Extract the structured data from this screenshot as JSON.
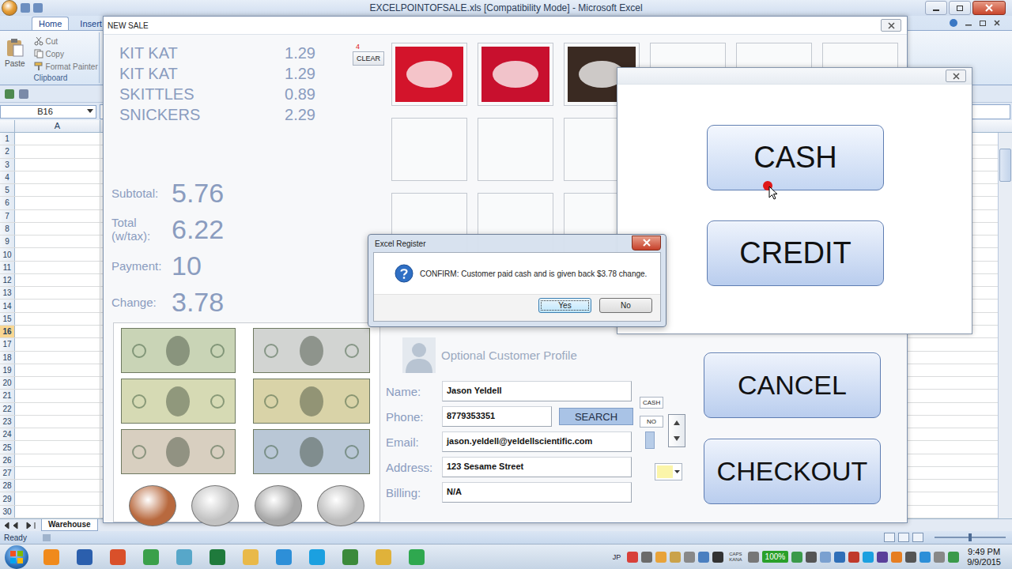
{
  "excel": {
    "title": "EXCELPOINTOFSALE.xls  [Compatibility Mode] - Microsoft Excel",
    "ribbon_tabs": [
      {
        "label": "Home",
        "selected": true
      },
      {
        "label": "Insert",
        "selected": false
      }
    ],
    "clipboard": {
      "paste": "Paste",
      "cut": "Cut",
      "copy": "Copy",
      "format_painter": "Format Painter",
      "group": "Clipboard"
    },
    "name_box": "B16",
    "columns": [
      "A"
    ],
    "rows": [
      {
        "label": "1",
        "selected": false
      },
      {
        "label": "2",
        "selected": false
      },
      {
        "label": "3",
        "selected": false
      },
      {
        "label": "4",
        "selected": false
      },
      {
        "label": "5",
        "selected": false
      },
      {
        "label": "6",
        "selected": false
      },
      {
        "label": "7",
        "selected": false
      },
      {
        "label": "8",
        "selected": false
      },
      {
        "label": "9",
        "selected": false
      },
      {
        "label": "10",
        "selected": false
      },
      {
        "label": "11",
        "selected": false
      },
      {
        "label": "12",
        "selected": false
      },
      {
        "label": "13",
        "selected": false
      },
      {
        "label": "14",
        "selected": false
      },
      {
        "label": "15",
        "selected": false
      },
      {
        "label": "16",
        "selected": true
      },
      {
        "label": "17",
        "selected": false
      },
      {
        "label": "18",
        "selected": false
      },
      {
        "label": "19",
        "selected": false
      },
      {
        "label": "20",
        "selected": false
      },
      {
        "label": "21",
        "selected": false
      },
      {
        "label": "22",
        "selected": false
      },
      {
        "label": "23",
        "selected": false
      },
      {
        "label": "24",
        "selected": false
      },
      {
        "label": "25",
        "selected": false
      },
      {
        "label": "26",
        "selected": false
      },
      {
        "label": "27",
        "selected": false
      },
      {
        "label": "28",
        "selected": false
      },
      {
        "label": "29",
        "selected": false
      },
      {
        "label": "30",
        "selected": false
      }
    ],
    "sheet_tabs": [
      {
        "label": "Warehouse",
        "selected": true
      }
    ],
    "status": "Ready"
  },
  "sale_form": {
    "title": "NEW SALE",
    "items": [
      {
        "name": "KIT KAT",
        "price": "1.29"
      },
      {
        "name": "KIT KAT",
        "price": "1.29"
      },
      {
        "name": "SKITTLES",
        "price": "0.89"
      },
      {
        "name": "SNICKERS",
        "price": "2.29"
      }
    ],
    "item_count": "4",
    "clear_button": "CLEAR",
    "totals": [
      {
        "label": "Subtotal:",
        "value": "5.76"
      },
      {
        "label": "Total (w/tax):",
        "value": "6.22"
      },
      {
        "label": "Payment:",
        "value": "10"
      },
      {
        "label": "Change:",
        "value": "3.78"
      }
    ],
    "products": [
      {
        "kind": "item",
        "color": "#d3142b"
      },
      {
        "kind": "item",
        "color": "#c8102e"
      },
      {
        "kind": "item",
        "color": "#3a2a22"
      },
      {
        "kind": "empty"
      },
      {
        "kind": "empty"
      },
      {
        "kind": "empty"
      },
      {
        "kind": "empty"
      },
      {
        "kind": "empty"
      },
      {
        "kind": "empty"
      },
      {
        "kind": "empty"
      },
      {
        "kind": "empty"
      },
      {
        "kind": "empty"
      },
      {
        "kind": "empty"
      },
      {
        "kind": "empty"
      },
      {
        "kind": "empty"
      },
      {
        "kind": "empty"
      },
      {
        "kind": "empty"
      },
      {
        "kind": "empty"
      }
    ],
    "money": [
      {
        "kind": "bill",
        "color": "#c9d4b6"
      },
      {
        "kind": "bill",
        "color": "#d2d4d2"
      },
      {
        "kind": "bill",
        "color": "#d6dab4"
      },
      {
        "kind": "bill",
        "color": "#d9d3a8"
      },
      {
        "kind": "bill",
        "color": "#d8cfc0"
      },
      {
        "kind": "bill",
        "color": "#b9c7d6"
      },
      {
        "kind": "coin",
        "color": "#b8693e"
      },
      {
        "kind": "coin",
        "color": "#c2c2c2"
      },
      {
        "kind": "coin",
        "color": "#a8a8a8"
      },
      {
        "kind": "coin",
        "color": "#bdbdbd"
      }
    ],
    "profile": {
      "heading": "Optional Customer Profile",
      "fields": [
        {
          "label": "Name:",
          "value": "Jason Yeldell",
          "kind": "text"
        },
        {
          "label": "Phone:",
          "value": "8779353351",
          "kind": "search"
        },
        {
          "label": "Email:",
          "value": "jason.yeldell@yeldellscientific.com",
          "kind": "text"
        },
        {
          "label": "Address:",
          "value": "123 Sesame Street",
          "kind": "text"
        },
        {
          "label": "Billing:",
          "value": "N/A",
          "kind": "text"
        }
      ],
      "search_button": "SEARCH"
    },
    "payment_type": "CASH",
    "flag": "NO",
    "color_picker": {
      "color": "#fbf5a9"
    },
    "cancel_button": "CANCEL",
    "checkout_button": "CHECKOUT"
  },
  "payment_form": {
    "buttons": [
      {
        "label": "CASH",
        "hovered": true
      },
      {
        "label": "CREDIT",
        "hovered": false
      }
    ]
  },
  "dialog": {
    "title": "Excel Register",
    "message": "CONFIRM: Customer paid cash and is given back $3.78 change.",
    "buttons": [
      {
        "label": "Yes",
        "selected": true
      },
      {
        "label": "No",
        "selected": false
      }
    ]
  },
  "taskbar": {
    "ime": "JP",
    "ime_flags": [
      "CAPS",
      "KANA"
    ],
    "battery": "100%",
    "time": "9:49 PM",
    "date": "9/9/2015"
  }
}
